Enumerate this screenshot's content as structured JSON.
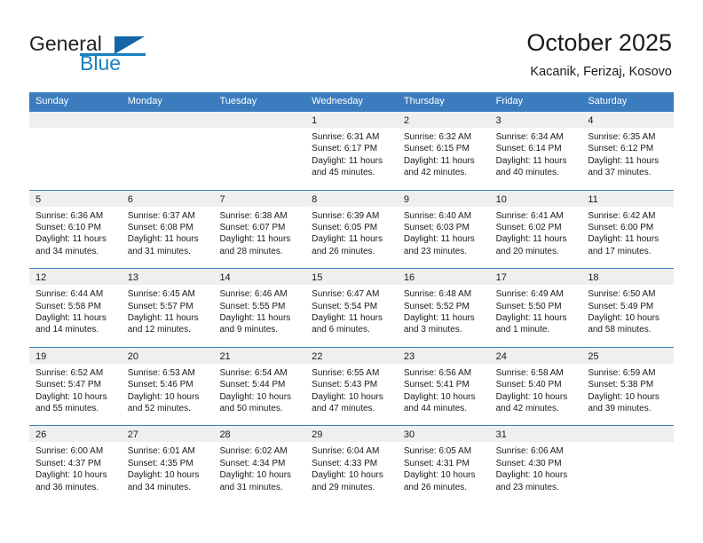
{
  "brand": {
    "name_part1": "General",
    "name_part2": "Blue",
    "logo_icon": "triangle-logo-icon"
  },
  "header": {
    "title": "October 2025",
    "subtitle": "Kacanik, Ferizaj, Kosovo"
  },
  "colors": {
    "header_blue": "#3a7cbe",
    "brand_blue": "#1a7fc1",
    "logo_blue": "#1565a8",
    "day_strip_gray": "#efeff0",
    "text": "#1a1a1a"
  },
  "weekdays": [
    "Sunday",
    "Monday",
    "Tuesday",
    "Wednesday",
    "Thursday",
    "Friday",
    "Saturday"
  ],
  "weeks": [
    [
      {
        "day": "",
        "empty": true
      },
      {
        "day": "",
        "empty": true
      },
      {
        "day": "",
        "empty": true
      },
      {
        "day": "1",
        "sunrise": "Sunrise: 6:31 AM",
        "sunset": "Sunset: 6:17 PM",
        "daylight1": "Daylight: 11 hours",
        "daylight2": "and 45 minutes."
      },
      {
        "day": "2",
        "sunrise": "Sunrise: 6:32 AM",
        "sunset": "Sunset: 6:15 PM",
        "daylight1": "Daylight: 11 hours",
        "daylight2": "and 42 minutes."
      },
      {
        "day": "3",
        "sunrise": "Sunrise: 6:34 AM",
        "sunset": "Sunset: 6:14 PM",
        "daylight1": "Daylight: 11 hours",
        "daylight2": "and 40 minutes."
      },
      {
        "day": "4",
        "sunrise": "Sunrise: 6:35 AM",
        "sunset": "Sunset: 6:12 PM",
        "daylight1": "Daylight: 11 hours",
        "daylight2": "and 37 minutes."
      }
    ],
    [
      {
        "day": "5",
        "sunrise": "Sunrise: 6:36 AM",
        "sunset": "Sunset: 6:10 PM",
        "daylight1": "Daylight: 11 hours",
        "daylight2": "and 34 minutes."
      },
      {
        "day": "6",
        "sunrise": "Sunrise: 6:37 AM",
        "sunset": "Sunset: 6:08 PM",
        "daylight1": "Daylight: 11 hours",
        "daylight2": "and 31 minutes."
      },
      {
        "day": "7",
        "sunrise": "Sunrise: 6:38 AM",
        "sunset": "Sunset: 6:07 PM",
        "daylight1": "Daylight: 11 hours",
        "daylight2": "and 28 minutes."
      },
      {
        "day": "8",
        "sunrise": "Sunrise: 6:39 AM",
        "sunset": "Sunset: 6:05 PM",
        "daylight1": "Daylight: 11 hours",
        "daylight2": "and 26 minutes."
      },
      {
        "day": "9",
        "sunrise": "Sunrise: 6:40 AM",
        "sunset": "Sunset: 6:03 PM",
        "daylight1": "Daylight: 11 hours",
        "daylight2": "and 23 minutes."
      },
      {
        "day": "10",
        "sunrise": "Sunrise: 6:41 AM",
        "sunset": "Sunset: 6:02 PM",
        "daylight1": "Daylight: 11 hours",
        "daylight2": "and 20 minutes."
      },
      {
        "day": "11",
        "sunrise": "Sunrise: 6:42 AM",
        "sunset": "Sunset: 6:00 PM",
        "daylight1": "Daylight: 11 hours",
        "daylight2": "and 17 minutes."
      }
    ],
    [
      {
        "day": "12",
        "sunrise": "Sunrise: 6:44 AM",
        "sunset": "Sunset: 5:58 PM",
        "daylight1": "Daylight: 11 hours",
        "daylight2": "and 14 minutes."
      },
      {
        "day": "13",
        "sunrise": "Sunrise: 6:45 AM",
        "sunset": "Sunset: 5:57 PM",
        "daylight1": "Daylight: 11 hours",
        "daylight2": "and 12 minutes."
      },
      {
        "day": "14",
        "sunrise": "Sunrise: 6:46 AM",
        "sunset": "Sunset: 5:55 PM",
        "daylight1": "Daylight: 11 hours",
        "daylight2": "and 9 minutes."
      },
      {
        "day": "15",
        "sunrise": "Sunrise: 6:47 AM",
        "sunset": "Sunset: 5:54 PM",
        "daylight1": "Daylight: 11 hours",
        "daylight2": "and 6 minutes."
      },
      {
        "day": "16",
        "sunrise": "Sunrise: 6:48 AM",
        "sunset": "Sunset: 5:52 PM",
        "daylight1": "Daylight: 11 hours",
        "daylight2": "and 3 minutes."
      },
      {
        "day": "17",
        "sunrise": "Sunrise: 6:49 AM",
        "sunset": "Sunset: 5:50 PM",
        "daylight1": "Daylight: 11 hours",
        "daylight2": "and 1 minute."
      },
      {
        "day": "18",
        "sunrise": "Sunrise: 6:50 AM",
        "sunset": "Sunset: 5:49 PM",
        "daylight1": "Daylight: 10 hours",
        "daylight2": "and 58 minutes."
      }
    ],
    [
      {
        "day": "19",
        "sunrise": "Sunrise: 6:52 AM",
        "sunset": "Sunset: 5:47 PM",
        "daylight1": "Daylight: 10 hours",
        "daylight2": "and 55 minutes."
      },
      {
        "day": "20",
        "sunrise": "Sunrise: 6:53 AM",
        "sunset": "Sunset: 5:46 PM",
        "daylight1": "Daylight: 10 hours",
        "daylight2": "and 52 minutes."
      },
      {
        "day": "21",
        "sunrise": "Sunrise: 6:54 AM",
        "sunset": "Sunset: 5:44 PM",
        "daylight1": "Daylight: 10 hours",
        "daylight2": "and 50 minutes."
      },
      {
        "day": "22",
        "sunrise": "Sunrise: 6:55 AM",
        "sunset": "Sunset: 5:43 PM",
        "daylight1": "Daylight: 10 hours",
        "daylight2": "and 47 minutes."
      },
      {
        "day": "23",
        "sunrise": "Sunrise: 6:56 AM",
        "sunset": "Sunset: 5:41 PM",
        "daylight1": "Daylight: 10 hours",
        "daylight2": "and 44 minutes."
      },
      {
        "day": "24",
        "sunrise": "Sunrise: 6:58 AM",
        "sunset": "Sunset: 5:40 PM",
        "daylight1": "Daylight: 10 hours",
        "daylight2": "and 42 minutes."
      },
      {
        "day": "25",
        "sunrise": "Sunrise: 6:59 AM",
        "sunset": "Sunset: 5:38 PM",
        "daylight1": "Daylight: 10 hours",
        "daylight2": "and 39 minutes."
      }
    ],
    [
      {
        "day": "26",
        "sunrise": "Sunrise: 6:00 AM",
        "sunset": "Sunset: 4:37 PM",
        "daylight1": "Daylight: 10 hours",
        "daylight2": "and 36 minutes."
      },
      {
        "day": "27",
        "sunrise": "Sunrise: 6:01 AM",
        "sunset": "Sunset: 4:35 PM",
        "daylight1": "Daylight: 10 hours",
        "daylight2": "and 34 minutes."
      },
      {
        "day": "28",
        "sunrise": "Sunrise: 6:02 AM",
        "sunset": "Sunset: 4:34 PM",
        "daylight1": "Daylight: 10 hours",
        "daylight2": "and 31 minutes."
      },
      {
        "day": "29",
        "sunrise": "Sunrise: 6:04 AM",
        "sunset": "Sunset: 4:33 PM",
        "daylight1": "Daylight: 10 hours",
        "daylight2": "and 29 minutes."
      },
      {
        "day": "30",
        "sunrise": "Sunrise: 6:05 AM",
        "sunset": "Sunset: 4:31 PM",
        "daylight1": "Daylight: 10 hours",
        "daylight2": "and 26 minutes."
      },
      {
        "day": "31",
        "sunrise": "Sunrise: 6:06 AM",
        "sunset": "Sunset: 4:30 PM",
        "daylight1": "Daylight: 10 hours",
        "daylight2": "and 23 minutes."
      },
      {
        "day": "",
        "empty": true
      }
    ]
  ]
}
